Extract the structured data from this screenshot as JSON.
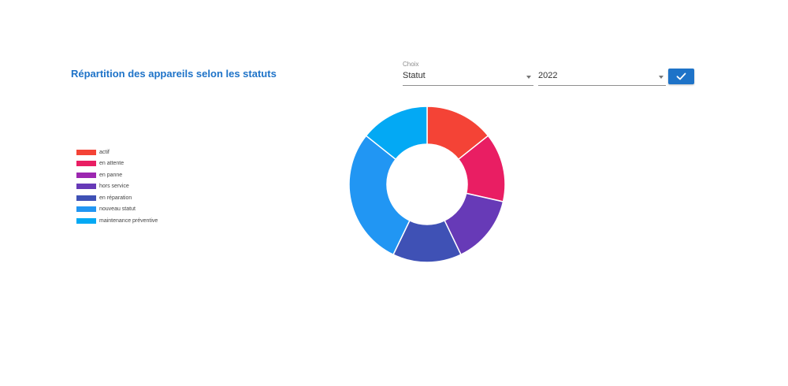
{
  "header": {
    "title": "Répartition des appareils selon les statuts"
  },
  "filters": {
    "choice_label": "Choix",
    "choice_value": "Statut",
    "year_value": "2022"
  },
  "confirm_icon": "check-icon",
  "chart_data": {
    "type": "pie",
    "variant": "donut",
    "legend_position": "left",
    "categories": [
      "actif",
      "en attente",
      "en panne",
      "hors service",
      "en réparation",
      "nouveau statut",
      "maintenance préventive"
    ],
    "values": [
      1,
      1,
      1,
      1,
      1,
      2,
      1
    ],
    "colors": [
      "#f44336",
      "#e91e63",
      "#9c27b0",
      "#673ab7",
      "#3f51b5",
      "#2196f3",
      "#03a9f4"
    ],
    "slice_colors": [
      "#f44336",
      "#e91e63",
      "#673ab7",
      "#3f51b5",
      "#2196f3",
      "#03a9f4"
    ],
    "slice_values": [
      1,
      1,
      1,
      1,
      2,
      1
    ]
  }
}
